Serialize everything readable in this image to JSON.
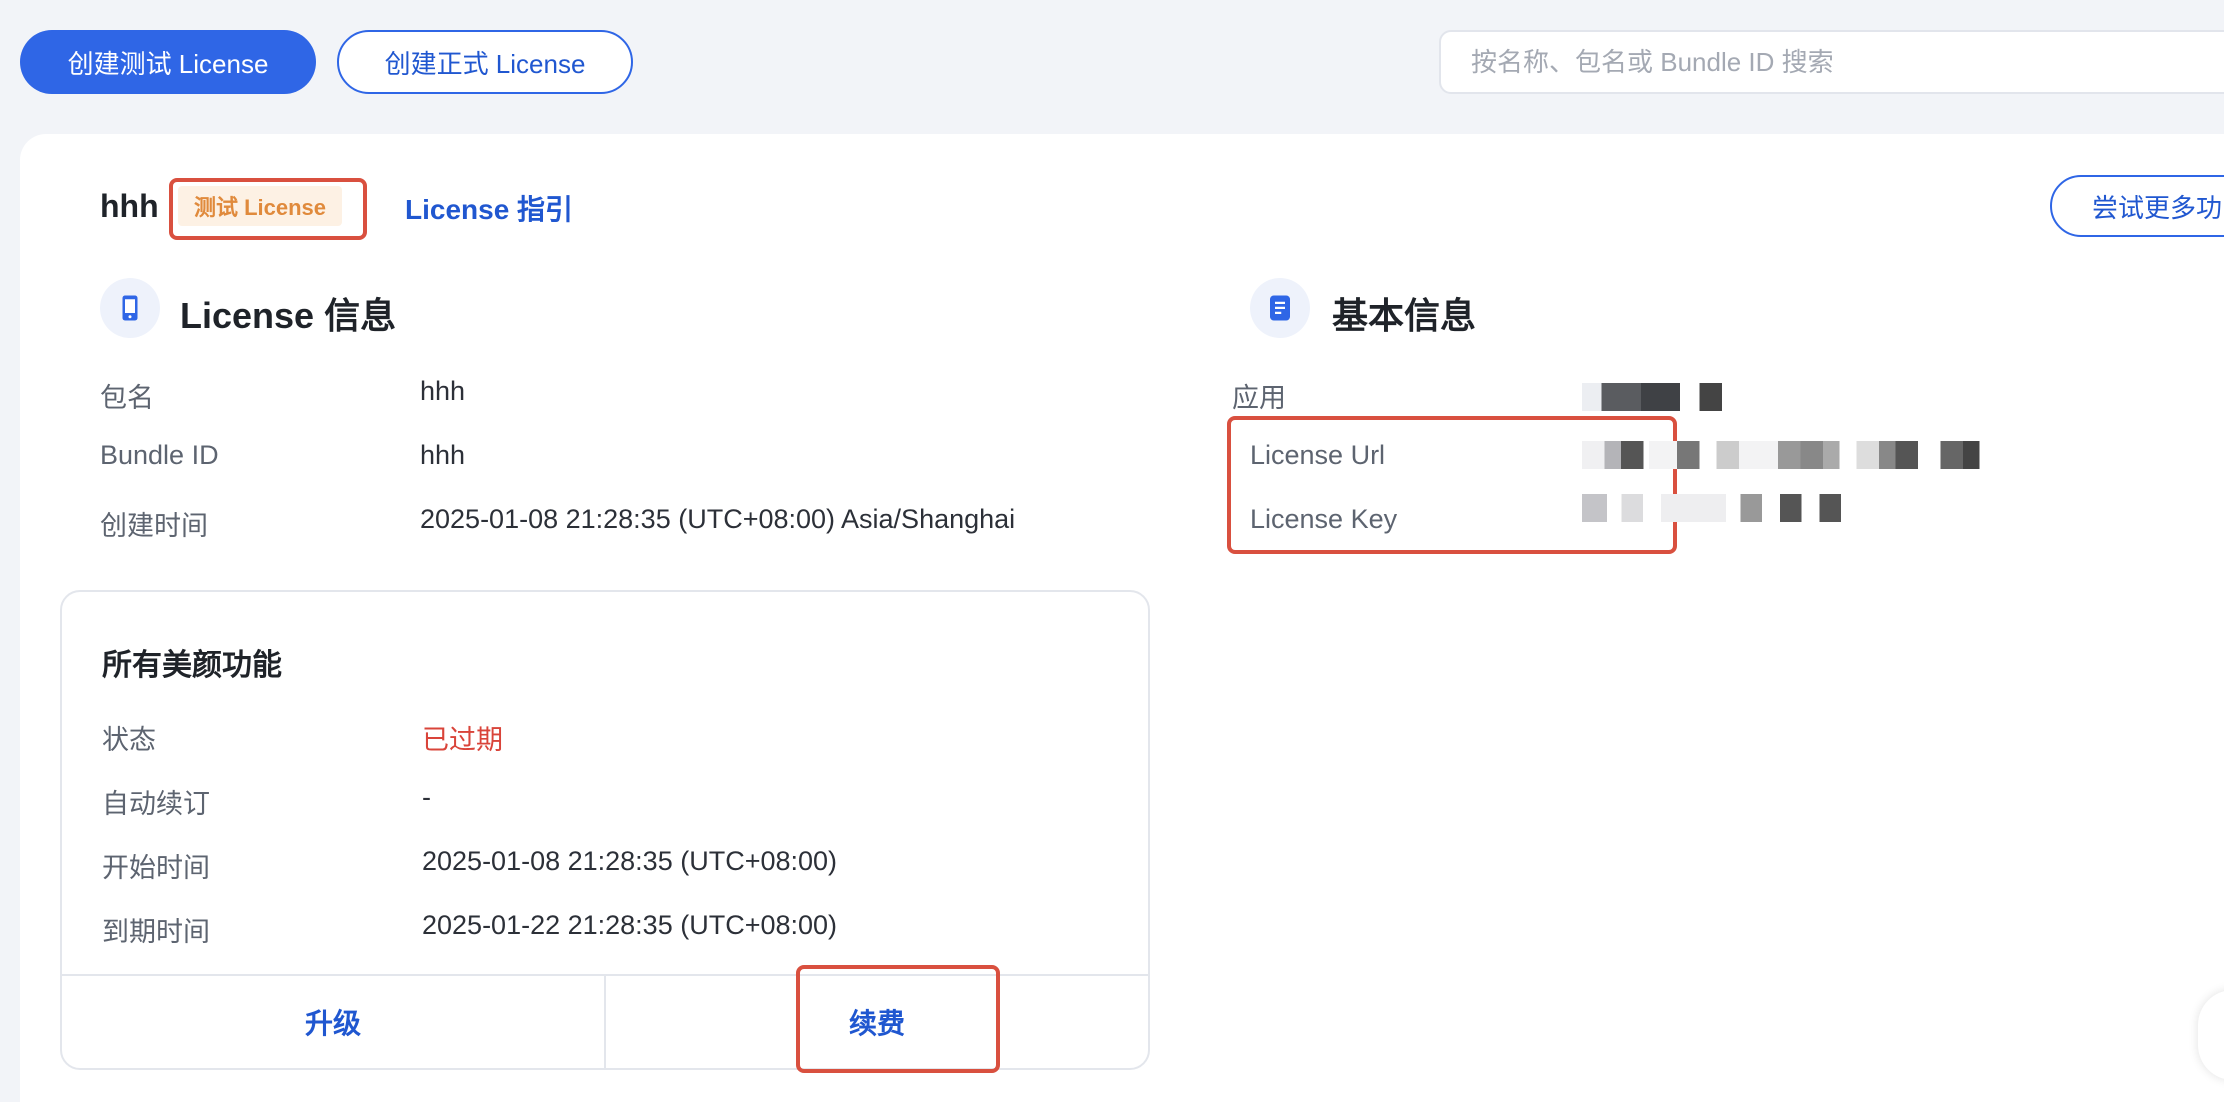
{
  "toolbar": {
    "create_test_label": "创建测试 License",
    "create_formal_label": "创建正式 License",
    "search_placeholder": "按名称、包名或 Bundle ID 搜索"
  },
  "header": {
    "name": "hhh",
    "tag": "测试 License",
    "guide_link": "License 指引",
    "try_more_label": "尝试更多功"
  },
  "license_info": {
    "title": "License 信息",
    "rows": [
      {
        "label": "包名",
        "value": "hhh"
      },
      {
        "label": "Bundle ID",
        "value": "hhh"
      },
      {
        "label": "创建时间",
        "value": "2025-01-08 21:28:35 (UTC+08:00) Asia/Shanghai"
      }
    ]
  },
  "basic_info": {
    "title": "基本信息",
    "rows": [
      {
        "label": "应用"
      },
      {
        "label": "License Url"
      },
      {
        "label": "License Key"
      }
    ]
  },
  "feature": {
    "title": "所有美颜功能",
    "rows": [
      {
        "label": "状态",
        "value": "已过期"
      },
      {
        "label": "自动续订",
        "value": "-"
      },
      {
        "label": "开始时间",
        "value": "2025-01-08 21:28:35 (UTC+08:00)"
      },
      {
        "label": "到期时间",
        "value": "2025-01-22 21:28:35 (UTC+08:00)"
      }
    ],
    "upgrade_label": "升级",
    "renew_label": "续费"
  },
  "colors": {
    "primary": "#2f66e6",
    "status_expired": "#d9443a",
    "tag_text": "#e08a3c",
    "highlight": "#d9503f"
  }
}
